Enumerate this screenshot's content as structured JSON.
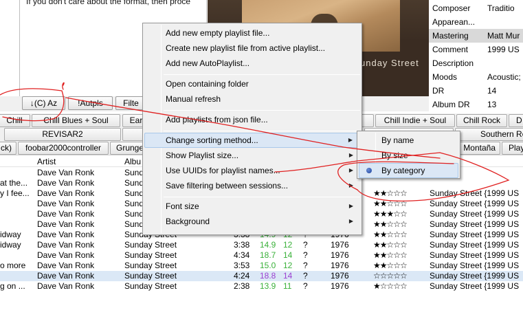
{
  "text_panel": {
    "text": "If you don't care about the format, then proce"
  },
  "album_art": {
    "caption": "unday Street"
  },
  "properties": [
    {
      "key": "Composer",
      "value": "Traditio"
    },
    {
      "key": "Apparean...",
      "value": ""
    },
    {
      "key": "Mastering",
      "value": "Matt Mur"
    },
    {
      "key": "Comment",
      "value": "1999 US"
    },
    {
      "key": "Description",
      "value": ""
    },
    {
      "key": "Moods",
      "value": "Acoustic;"
    },
    {
      "key": "DR",
      "value": "14"
    },
    {
      "key": "Album DR",
      "value": "13"
    }
  ],
  "buttons": {
    "sort": "↓(C) Az",
    "autopls": "!Autpls",
    "filter": "Filte"
  },
  "tabs_row1": [
    "Chill",
    "Chill Blues + Soul",
    "Ear",
    "p",
    "Chill Indie + Soul",
    "Chill Rock",
    "D"
  ],
  "tabs_row2": [
    "REVISAR2",
    "",
    "Southern Ro"
  ],
  "tabs_row3": [
    "ck)",
    "foobar2000controller",
    "Grunge",
    "Montaña",
    "Play"
  ],
  "playlist": {
    "headers": {
      "artist": "Artist",
      "album": "Albu"
    },
    "rows": [
      {
        "title": "",
        "artist": "Dave Van Ronk",
        "album": "Sund",
        "length": "",
        "dr": "",
        "count": "",
        "q": "",
        "year": "",
        "rating": 0,
        "album2": "",
        "dr_color": "#3ab13a"
      },
      {
        "title": "at the...",
        "artist": "Dave Van Ronk",
        "album": "Sund",
        "length": "",
        "dr": "",
        "count": "",
        "q": "",
        "year": "",
        "rating": 0,
        "album2": "",
        "dr_color": "#3ab13a"
      },
      {
        "title": "y I fee...",
        "artist": "Dave Van Ronk",
        "album": "Sund",
        "length": "",
        "dr": "",
        "count": "",
        "q": "",
        "year": "",
        "rating": 2,
        "album2": "Sunday Street {1999 US",
        "dr_color": "#3ab13a"
      },
      {
        "title": "",
        "artist": "Dave Van Ronk",
        "album": "Sund",
        "length": "",
        "dr": "",
        "count": "",
        "q": "",
        "year": "",
        "rating": 2,
        "album2": "Sunday Street {1999 US",
        "dr_color": "#3ab13a"
      },
      {
        "title": "",
        "artist": "Dave Van Ronk",
        "album": "Sund",
        "length": "",
        "dr": "",
        "count": "",
        "q": "",
        "year": "",
        "rating": 3,
        "album2": "Sunday Street {1999 US",
        "dr_color": "#3ab13a"
      },
      {
        "title": "",
        "artist": "Dave Van Ronk",
        "album": "Sund",
        "length": "",
        "dr": "",
        "count": "",
        "q": "",
        "year": "",
        "rating": 2,
        "album2": "Sunday Street {1999 US",
        "dr_color": "#3ab13a"
      },
      {
        "title": "idway",
        "artist": "Dave Van Ronk",
        "album": "Sunday Street",
        "length": "3:38",
        "dr": "14.9",
        "count": "12",
        "q": "?",
        "year": "1976",
        "rating": 2,
        "album2": "Sunday Street {1999 US",
        "dr_color": "#3ab13a"
      },
      {
        "title": "idway",
        "artist": "Dave Van Ronk",
        "album": "Sunday Street",
        "length": "3:38",
        "dr": "14.9",
        "count": "12",
        "q": "?",
        "year": "1976",
        "rating": 2,
        "album2": "Sunday Street {1999 US",
        "dr_color": "#3ab13a"
      },
      {
        "title": "",
        "artist": "Dave Van Ronk",
        "album": "Sunday Street",
        "length": "4:34",
        "dr": "18.7",
        "count": "14",
        "q": "?",
        "year": "1976",
        "rating": 2,
        "album2": "Sunday Street {1999 US",
        "dr_color": "#3ab13a"
      },
      {
        "title": "o more",
        "artist": "Dave Van Ronk",
        "album": "Sunday Street",
        "length": "3:53",
        "dr": "15.0",
        "count": "12",
        "q": "?",
        "year": "1976",
        "rating": 2,
        "album2": "Sunday Street {1999 US",
        "dr_color": "#3ab13a"
      },
      {
        "title": "",
        "artist": "Dave Van Ronk",
        "album": "Sunday Street",
        "length": "4:24",
        "dr": "18.8",
        "count": "14",
        "q": "?",
        "year": "1976",
        "rating": 0,
        "album2": "Sunday Street {1999 US",
        "dr_color": "#9c3fd1"
      },
      {
        "title": "g on ...",
        "artist": "Dave Van Ronk",
        "album": "Sunday Street",
        "length": "2:38",
        "dr": "13.9",
        "count": "11",
        "q": "?",
        "year": "1976",
        "rating": 1,
        "album2": "Sunday Street {1999 US",
        "dr_color": "#3ab13a"
      }
    ]
  },
  "menu": {
    "items": [
      "Add new empty playlist file...",
      "Create new playlist file from active playlist...",
      "Add new AutoPlaylist...",
      "Open containing folder",
      "Manual refresh",
      "Add playlists from json file...",
      "Change sorting method...",
      "Show Playlist size...",
      "Use UUIDs for playlist names...",
      "Save filtering between sessions...",
      "Font size",
      "Background"
    ]
  },
  "submenu": {
    "items": [
      "By name",
      "By size",
      "By category"
    ],
    "selected": "By category"
  },
  "colors": {
    "menu_hover": "#dbe7f5",
    "radio": "#1b3f9a",
    "annotation": "#e02020",
    "dr_green": "#3ab13a",
    "dr_purple": "#9c3fd1"
  }
}
